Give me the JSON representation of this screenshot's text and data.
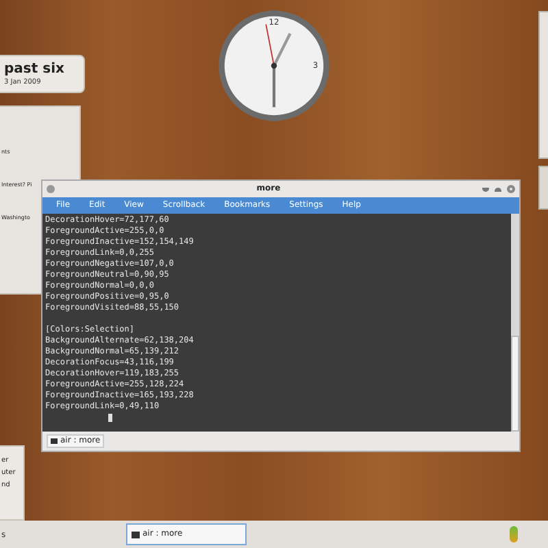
{
  "clock_widget": {
    "time_text": "past six",
    "date": "3 Jan 2009"
  },
  "news_widget": {
    "lines": [
      "nts",
      "Interest? Pi",
      "Washingto"
    ]
  },
  "bottom_widget": {
    "lines": [
      "er",
      "uter",
      "nd"
    ]
  },
  "clock": {
    "numerals": [
      "12",
      "3"
    ]
  },
  "terminal": {
    "title": "more",
    "menu": [
      "File",
      "Edit",
      "View",
      "Scrollback",
      "Bookmarks",
      "Settings",
      "Help"
    ],
    "lines": [
      "DecorationHover=72,177,60",
      "ForegroundActive=255,0,0",
      "ForegroundInactive=152,154,149",
      "ForegroundLink=0,0,255",
      "ForegroundNegative=107,0,0",
      "ForegroundNeutral=0,90,95",
      "ForegroundNormal=0,0,0",
      "ForegroundPositive=0,95,0",
      "ForegroundVisited=88,55,150"
    ],
    "section_header": "[Colors:Selection]",
    "section_lines": [
      "BackgroundAlternate=62,138,204",
      "BackgroundNormal=65,139,212",
      "DecorationFocus=43,116,199",
      "DecorationHover=119,183,255",
      "ForegroundActive=255,128,224",
      "ForegroundInactive=165,193,228",
      "ForegroundLink=0,49,110"
    ],
    "tab_label": "air : more"
  },
  "taskbar": {
    "left_text": "s",
    "tasks": [
      {
        "label": "air : more",
        "selected": true
      }
    ]
  }
}
